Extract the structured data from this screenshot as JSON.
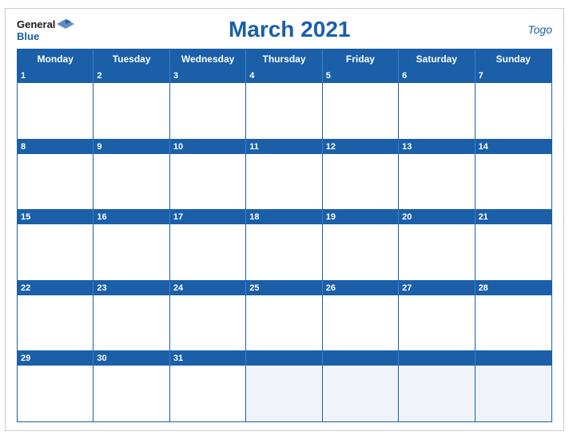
{
  "logo": {
    "general": "General",
    "blue": "Blue"
  },
  "title": "March 2021",
  "country": "Togo",
  "days": [
    "Monday",
    "Tuesday",
    "Wednesday",
    "Thursday",
    "Friday",
    "Saturday",
    "Sunday"
  ],
  "weeks": [
    {
      "dates": [
        "1",
        "2",
        "3",
        "4",
        "5",
        "6",
        "7"
      ]
    },
    {
      "dates": [
        "8",
        "9",
        "10",
        "11",
        "12",
        "13",
        "14"
      ]
    },
    {
      "dates": [
        "15",
        "16",
        "17",
        "18",
        "19",
        "20",
        "21"
      ]
    },
    {
      "dates": [
        "22",
        "23",
        "24",
        "25",
        "26",
        "27",
        "28"
      ]
    },
    {
      "dates": [
        "29",
        "30",
        "31",
        "",
        "",
        "",
        ""
      ]
    }
  ]
}
